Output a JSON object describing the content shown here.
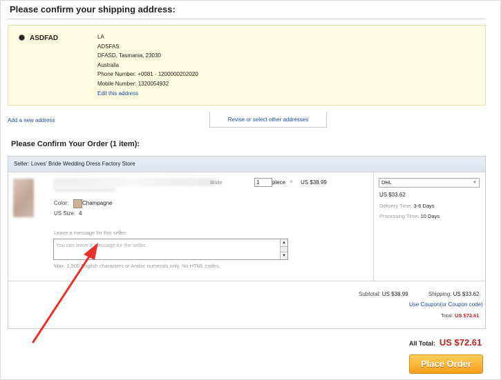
{
  "shipping_section": {
    "title": "Please confirm your shipping address:",
    "address": {
      "name": "ASDFAD",
      "lines": [
        "LA",
        "ADSFAS",
        "DFASD, Tasmania, 23030",
        "Australia",
        "Phone Number:  +0081 - 1200000202020",
        "Mobile Number:  1320054932"
      ],
      "edit_link": "Edit this address"
    },
    "add_link": "Add a new address",
    "revise_button": "Revise or select other addresses"
  },
  "order_section": {
    "title": "Please Confirm Your Order (1 item):",
    "seller": "Seller: Loves' Bride Wedding Dress Factory Store",
    "item": {
      "title_suffix": "Bride",
      "quantity": "1",
      "unit": "piece",
      "times": "×",
      "price": "US $38.99",
      "color_label": "Color:",
      "color_value": "Champagne",
      "size_label": "US Size:",
      "size_value": "4",
      "message_label": "Leave a message for this seller:",
      "message_placeholder": "You can leave a message for the seller.",
      "message_hint": "Max. 1,500 English characters or Arabic numerals only. No HTML codes."
    },
    "shipping": {
      "method": "DHL",
      "cost": "US $33.62",
      "delivery_label": "Delivery Time:",
      "delivery_value": "3-6 Days",
      "processing_label": "Processing Time:",
      "processing_value": "10 Days"
    },
    "summary": {
      "subtotal_label": "Subtotal:",
      "subtotal_value": "US $38.99",
      "shipping_label": "Shipping:",
      "shipping_value": "US $33.62",
      "coupon_link": "Use Coupon(or Coupon code)",
      "total_label": "Total:",
      "total_value": "US $72.61"
    }
  },
  "footer": {
    "all_total_label": "All Total:",
    "all_total_value": "US $72.61",
    "place_order": "Place Order"
  },
  "colors": {
    "accent_link": "#1a4aa5",
    "price_red": "#c41e1e",
    "button_orange": "#f59d1d",
    "address_bg": "#fffbe0",
    "annotation_arrow": "#e8312a"
  }
}
